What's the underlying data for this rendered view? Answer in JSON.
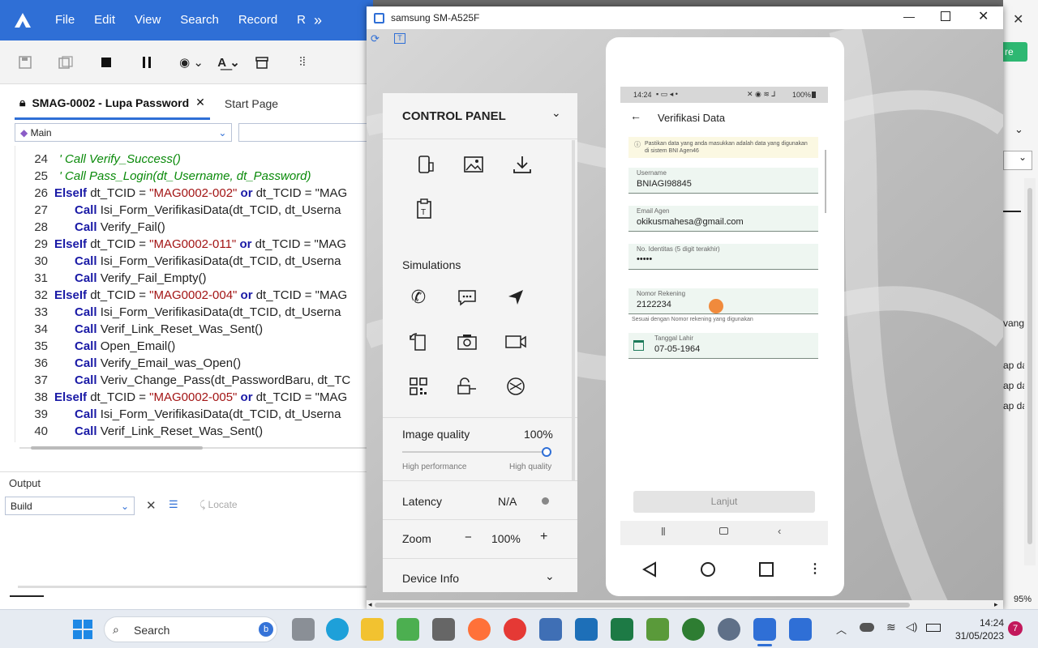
{
  "ide": {
    "menu": [
      "File",
      "Edit",
      "View",
      "Search",
      "Record",
      "R"
    ],
    "tabs": {
      "active": "SMAG-0002 - Lupa Password",
      "other": "Start Page"
    },
    "combo": {
      "left": "Main",
      "right": ""
    },
    "code": [
      {
        "n": "24",
        "type": "comment",
        "text": "'    Call Verify_Success()"
      },
      {
        "n": "25",
        "type": "comment",
        "text": "'    Call Pass_Login(dt_Username, dt_Password)"
      },
      {
        "n": "26",
        "type": "elseif",
        "id": "\"MAG0002-002\"",
        "tail": "dt_TCID = \"MAG"
      },
      {
        "n": "27",
        "type": "call",
        "name": "Isi_Form_VerifikasiData(dt_TCID, dt_Userna"
      },
      {
        "n": "28",
        "type": "call",
        "name": "Verify_Fail()"
      },
      {
        "n": "29",
        "type": "elseif",
        "id": "\"MAG0002-011\"",
        "tail": "dt_TCID = \"MAG"
      },
      {
        "n": "30",
        "type": "call",
        "name": "Isi_Form_VerifikasiData(dt_TCID, dt_Userna"
      },
      {
        "n": "31",
        "type": "call",
        "name": "Verify_Fail_Empty()"
      },
      {
        "n": "32",
        "type": "elseif",
        "id": "\"MAG0002-004\"",
        "tail": "dt_TCID = \"MAG"
      },
      {
        "n": "33",
        "type": "call",
        "name": "Isi_Form_VerifikasiData(dt_TCID, dt_Userna"
      },
      {
        "n": "34",
        "type": "call",
        "name": "Verif_Link_Reset_Was_Sent()"
      },
      {
        "n": "35",
        "type": "call",
        "name": "Open_Email()"
      },
      {
        "n": "36",
        "type": "call",
        "name": "Verify_Email_was_Open()"
      },
      {
        "n": "37",
        "type": "call",
        "name": "Veriv_Change_Pass(dt_PasswordBaru, dt_TC"
      },
      {
        "n": "38",
        "type": "elseif",
        "id": "\"MAG0002-005\"",
        "tail": "dt_TCID = \"MAG"
      },
      {
        "n": "39",
        "type": "call",
        "name": "Isi_Form_VerifikasiData(dt_TCID, dt_Userna"
      },
      {
        "n": "40",
        "type": "call",
        "name": "Verif_Link_Reset_Was_Sent()"
      }
    ],
    "kw": {
      "elseif": "ElseIf",
      "call": "Call",
      "or": "or",
      "tcid": "dt_TCID ="
    },
    "output": {
      "title": "Output",
      "select": "Build",
      "locate": "Locate"
    }
  },
  "emulator": {
    "title": "samsung SM-A525F",
    "panel": {
      "title": "CONTROL PANEL",
      "simulations": "Simulations",
      "image_quality": {
        "label": "Image quality",
        "value": "100%",
        "level": 1.0,
        "left": "High performance",
        "right": "High quality"
      },
      "latency": {
        "label": "Latency",
        "value": "N/A"
      },
      "zoom": {
        "label": "Zoom",
        "value": "100%",
        "minus": "−",
        "plus": "+"
      },
      "device_info": "Device Info"
    },
    "phone": {
      "status_time": "14:24",
      "status_right": "100%",
      "header": "Verifikasi Data",
      "notice": "Pastikan data yang anda masukkan adalah data yang digunakan di sistem BNI Agen46",
      "fields": [
        {
          "label": "Username",
          "value": "BNIAGI98845"
        },
        {
          "label": "Email Agen",
          "value": "okikusmahesa@gmail.com"
        },
        {
          "label": "No. Identitas (5 digit terakhir)",
          "value": "•••••"
        },
        {
          "label": "Nomor Rekening",
          "value": "2122234"
        },
        {
          "label": "Tanggal Lahir",
          "value": "07-05-1964"
        }
      ],
      "helper": "Sesuai dengan Nomor rekening yang digunakan",
      "button": "Lanjut"
    }
  },
  "right_edge": {
    "zoom": "95%",
    "badge_text": "re",
    "rows": [
      "vang",
      "ap da",
      "ap da",
      "ap da"
    ]
  },
  "taskbar": {
    "search": "Search",
    "time": "14:24",
    "date": "31/05/2023",
    "notif": "7"
  }
}
